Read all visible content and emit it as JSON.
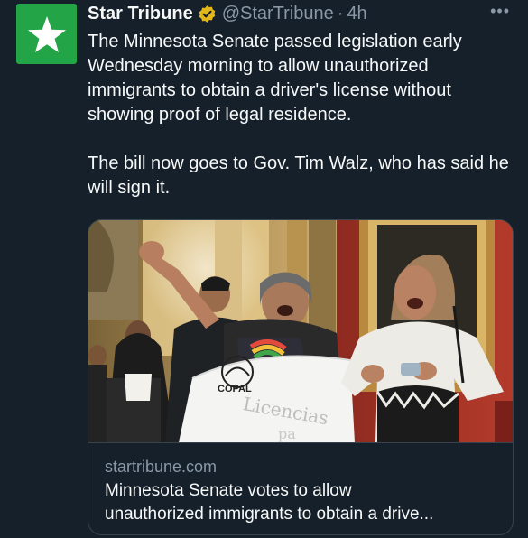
{
  "tweet": {
    "author_name": "Star Tribune",
    "handle": "@StarTribune",
    "separator": "·",
    "time": "4h",
    "more_label": "•••",
    "paragraph_1": "The Minnesota Senate passed legislation early Wednesday morning to allow unauthorized immigrants to obtain a driver's license without showing proof of legal residence.",
    "paragraph_2": "The bill now goes to Gov. Tim Walz, who has said he will sign it."
  },
  "card": {
    "sign_logo_text": "COPAL",
    "sign_handwriting": "Licencias",
    "sign_handwriting_2": "pa",
    "domain": "startribune.com",
    "title_line_1": "Minnesota Senate votes to allow",
    "title_line_2": "unauthorized immigrants to obtain a drive..."
  },
  "icons": {
    "avatar": "star-logo-icon",
    "verified": "verified-badge-icon",
    "more": "more-options-icon"
  },
  "colors": {
    "background": "#15202b",
    "brand_green": "#22a447",
    "verified_gold": "#e2b719",
    "secondary_text": "#8b98a5",
    "border": "#38444d"
  }
}
